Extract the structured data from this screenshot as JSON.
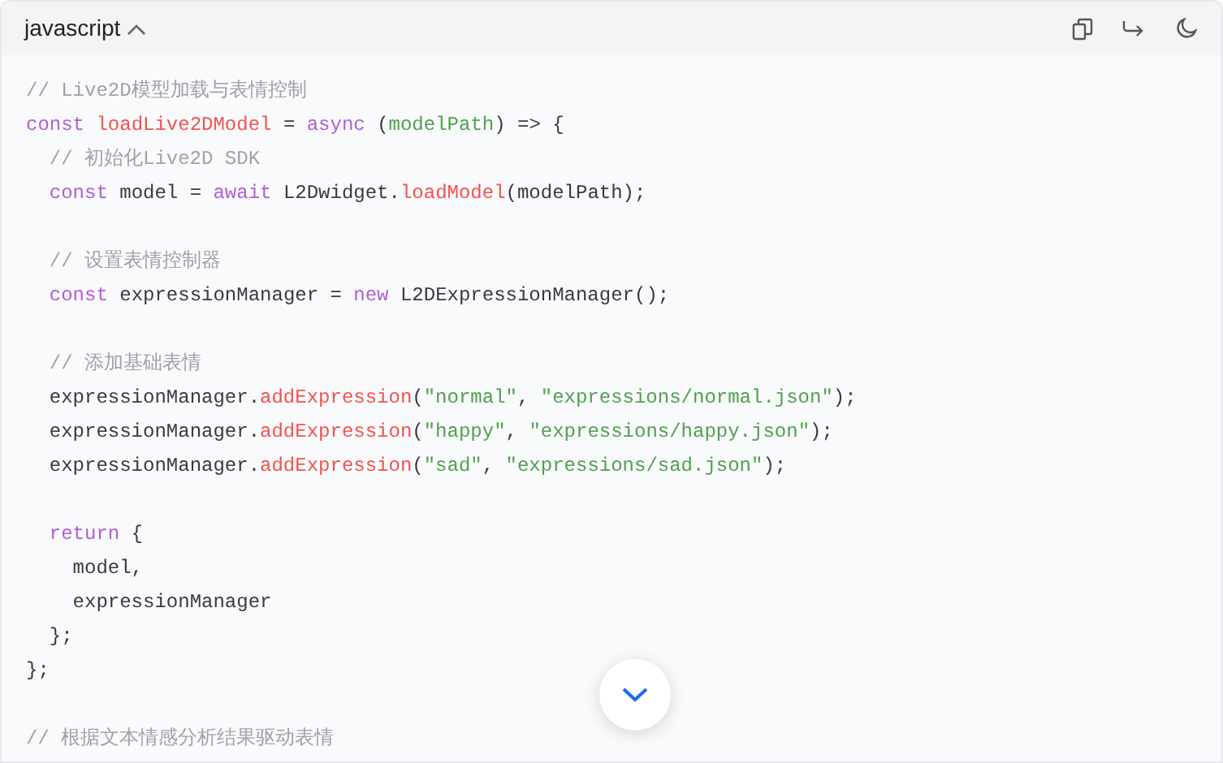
{
  "header": {
    "language": "javascript"
  },
  "lines": [
    {
      "kind": "code",
      "tokens": [
        {
          "kind": "comment",
          "text": "// Live2D模型加载与表情控制"
        }
      ]
    },
    {
      "kind": "code",
      "tokens": [
        {
          "kind": "keyword",
          "text": "const "
        },
        {
          "kind": "function",
          "text": "loadLive2DModel"
        },
        {
          "kind": "plain",
          "text": " = "
        },
        {
          "kind": "keyword",
          "text": "async"
        },
        {
          "kind": "plain",
          "text": " ("
        },
        {
          "kind": "string",
          "text": "modelPath"
        },
        {
          "kind": "plain",
          "text": ") => {"
        }
      ]
    },
    {
      "kind": "code",
      "tokens": [
        {
          "kind": "comment",
          "text": "  // 初始化Live2D SDK"
        }
      ]
    },
    {
      "kind": "code",
      "tokens": [
        {
          "kind": "keyword",
          "text": "  const"
        },
        {
          "kind": "plain",
          "text": " model = "
        },
        {
          "kind": "keyword",
          "text": "await"
        },
        {
          "kind": "plain",
          "text": " L2Dwidget."
        },
        {
          "kind": "function",
          "text": "loadModel"
        },
        {
          "kind": "plain",
          "text": "(modelPath);"
        }
      ]
    },
    {
      "kind": "blank"
    },
    {
      "kind": "code",
      "tokens": [
        {
          "kind": "comment",
          "text": "  // 设置表情控制器"
        }
      ]
    },
    {
      "kind": "code",
      "tokens": [
        {
          "kind": "keyword",
          "text": "  const"
        },
        {
          "kind": "plain",
          "text": " expressionManager = "
        },
        {
          "kind": "keyword",
          "text": "new"
        },
        {
          "kind": "plain",
          "text": " L2DExpressionManager();"
        }
      ]
    },
    {
      "kind": "blank"
    },
    {
      "kind": "code",
      "tokens": [
        {
          "kind": "comment",
          "text": "  // 添加基础表情"
        }
      ]
    },
    {
      "kind": "code",
      "tokens": [
        {
          "kind": "plain",
          "text": "  expressionManager."
        },
        {
          "kind": "function",
          "text": "addExpression"
        },
        {
          "kind": "plain",
          "text": "("
        },
        {
          "kind": "string",
          "text": "\"normal\""
        },
        {
          "kind": "plain",
          "text": ", "
        },
        {
          "kind": "string",
          "text": "\"expressions/normal.json\""
        },
        {
          "kind": "plain",
          "text": ");"
        }
      ]
    },
    {
      "kind": "code",
      "tokens": [
        {
          "kind": "plain",
          "text": "  expressionManager."
        },
        {
          "kind": "function",
          "text": "addExpression"
        },
        {
          "kind": "plain",
          "text": "("
        },
        {
          "kind": "string",
          "text": "\"happy\""
        },
        {
          "kind": "plain",
          "text": ", "
        },
        {
          "kind": "string",
          "text": "\"expressions/happy.json\""
        },
        {
          "kind": "plain",
          "text": ");"
        }
      ]
    },
    {
      "kind": "code",
      "tokens": [
        {
          "kind": "plain",
          "text": "  expressionManager."
        },
        {
          "kind": "function",
          "text": "addExpression"
        },
        {
          "kind": "plain",
          "text": "("
        },
        {
          "kind": "string",
          "text": "\"sad\""
        },
        {
          "kind": "plain",
          "text": ", "
        },
        {
          "kind": "string",
          "text": "\"expressions/sad.json\""
        },
        {
          "kind": "plain",
          "text": ");"
        }
      ]
    },
    {
      "kind": "blank"
    },
    {
      "kind": "code",
      "tokens": [
        {
          "kind": "keyword",
          "text": "  return"
        },
        {
          "kind": "plain",
          "text": " {"
        }
      ]
    },
    {
      "kind": "code",
      "tokens": [
        {
          "kind": "plain",
          "text": "    model,"
        }
      ]
    },
    {
      "kind": "code",
      "tokens": [
        {
          "kind": "plain",
          "text": "    expressionManager"
        }
      ]
    },
    {
      "kind": "code",
      "tokens": [
        {
          "kind": "plain",
          "text": "  };"
        }
      ]
    },
    {
      "kind": "code",
      "tokens": [
        {
          "kind": "plain",
          "text": "};"
        }
      ]
    },
    {
      "kind": "blank"
    },
    {
      "kind": "code",
      "tokens": [
        {
          "kind": "comment",
          "text": "// 根据文本情感分析结果驱动表情"
        }
      ]
    }
  ]
}
